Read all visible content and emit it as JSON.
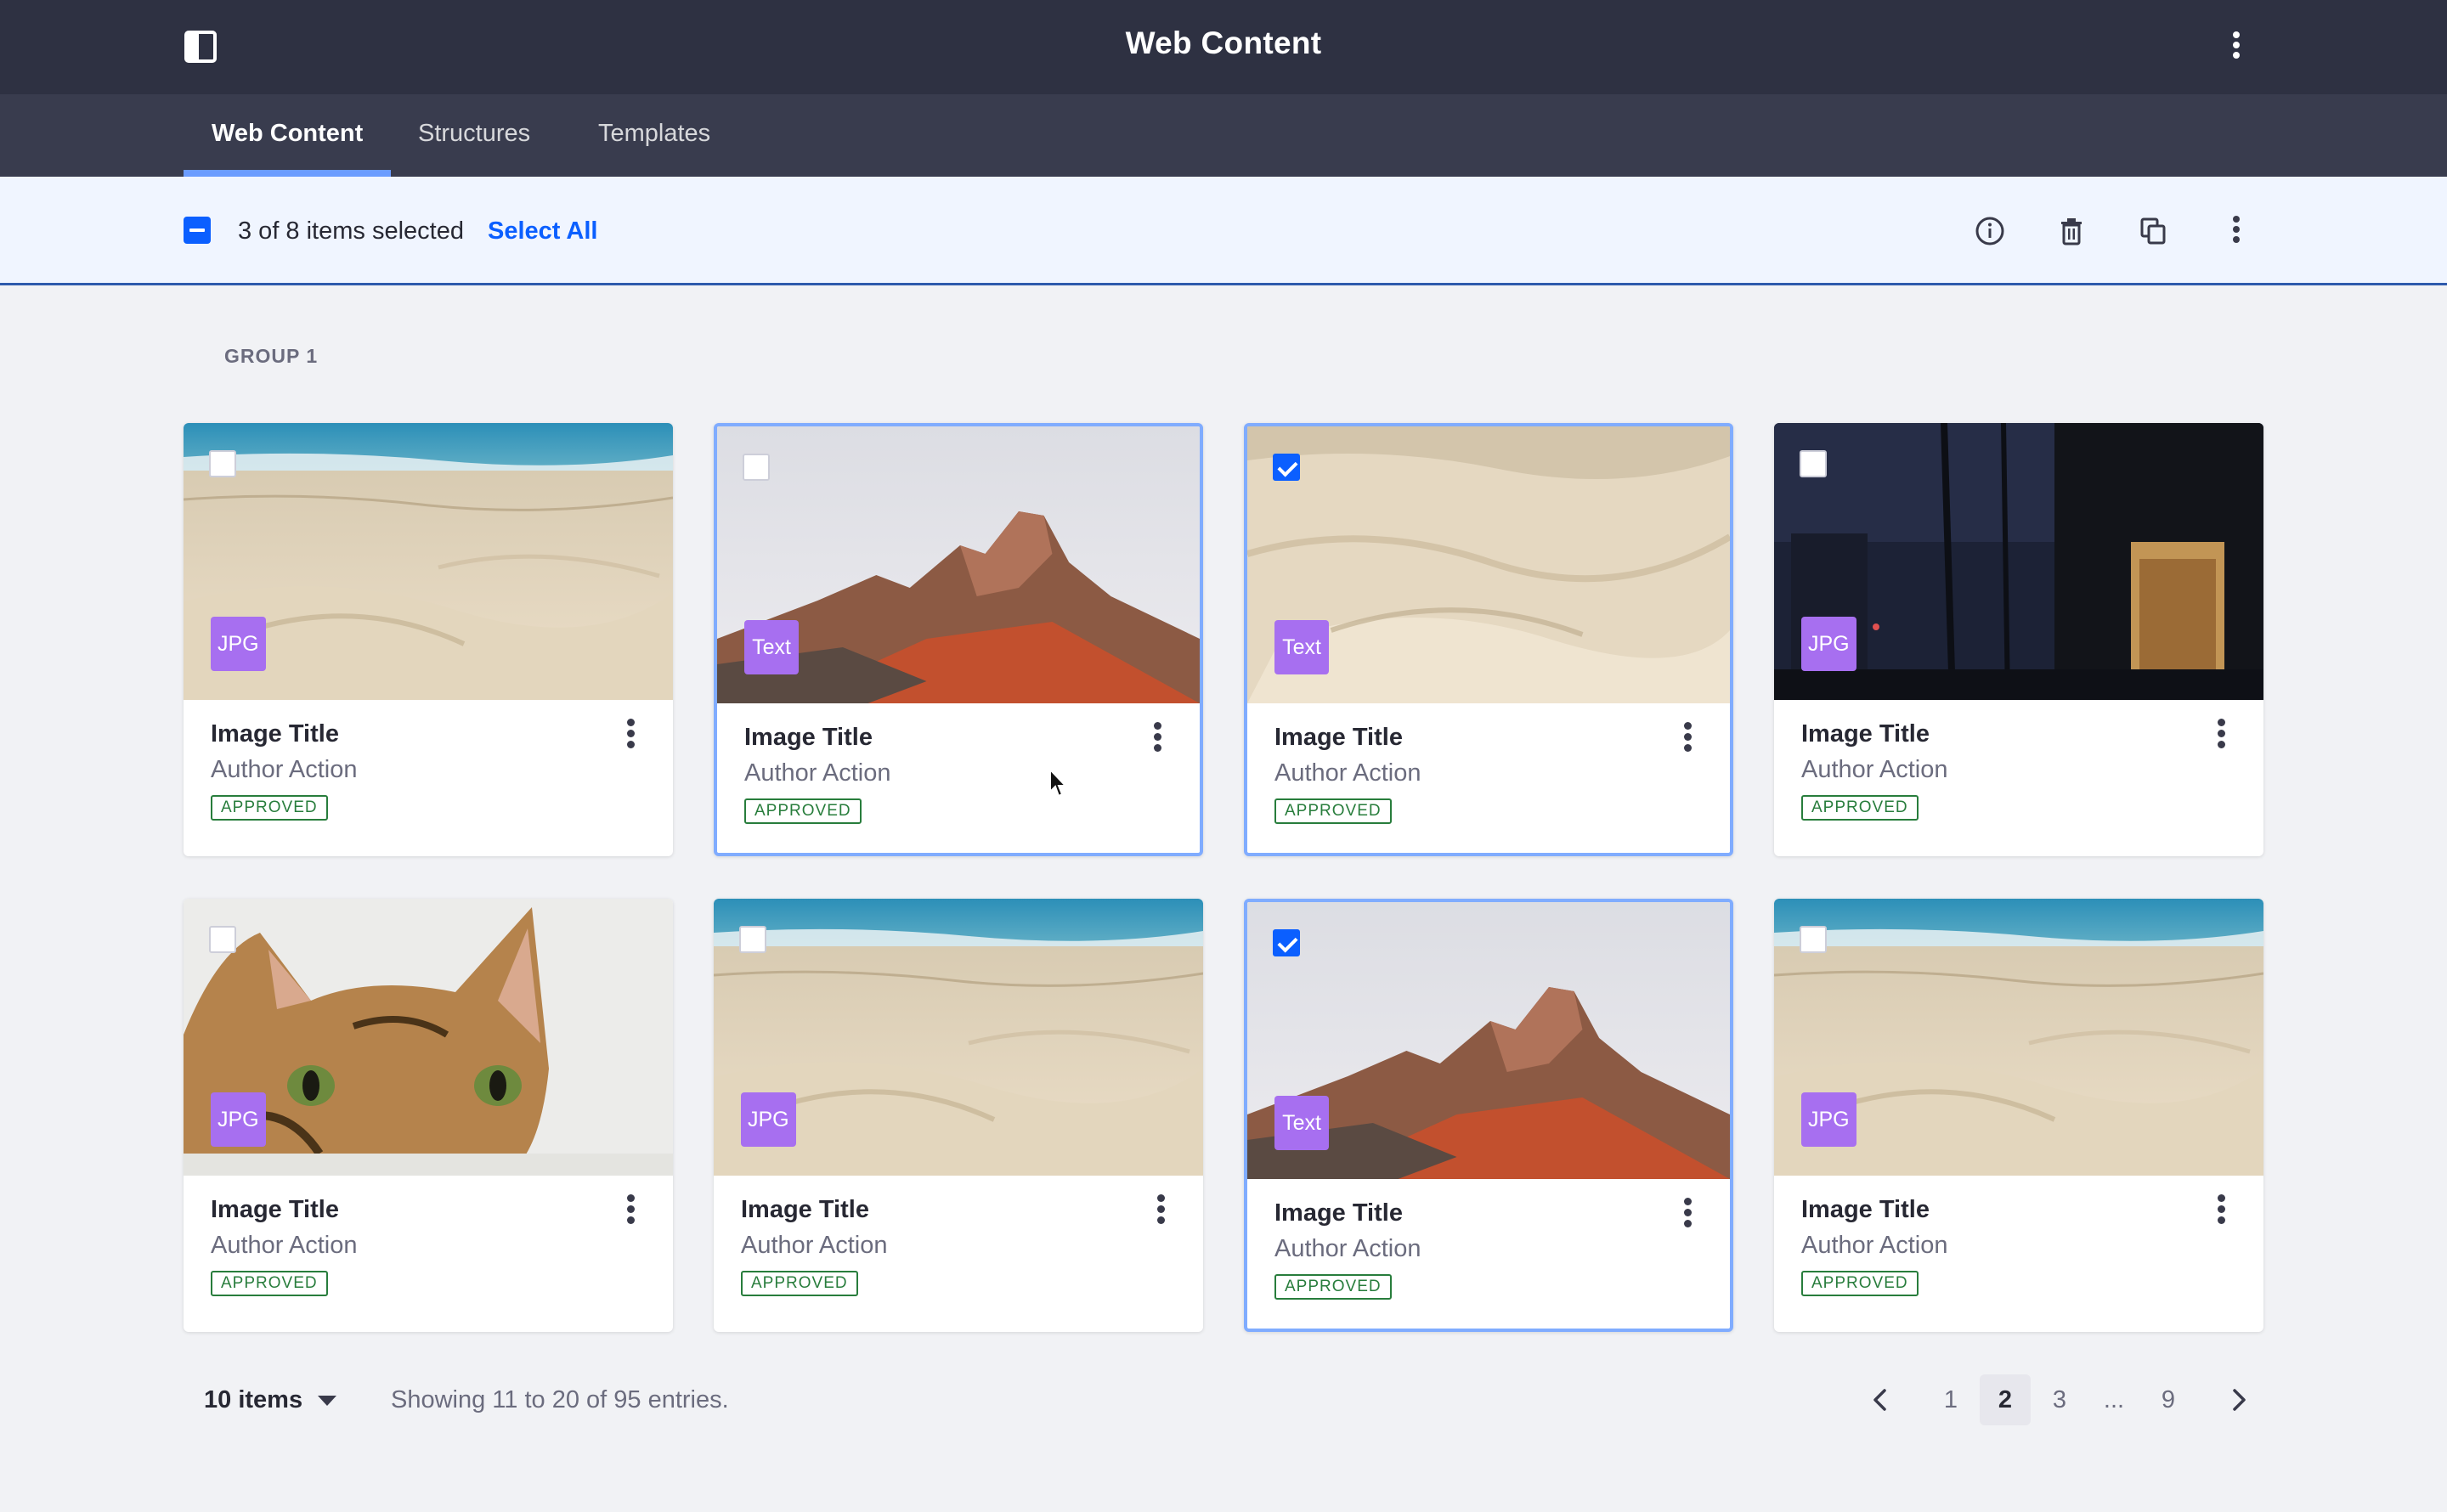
{
  "app": {
    "title": "Web Content"
  },
  "tabs": [
    {
      "label": "Web Content",
      "active": true
    },
    {
      "label": "Structures",
      "active": false
    },
    {
      "label": "Templates",
      "active": false
    }
  ],
  "management_bar": {
    "selection_text": "3 of 8 items selected",
    "select_all_label": "Select All",
    "actions": [
      "info-icon",
      "trash-icon",
      "copy-icon",
      "kebab-icon"
    ]
  },
  "group": {
    "label": "GROUP 1"
  },
  "cards": [
    {
      "title": "Image Title",
      "subtitle": "Author Action",
      "status": "APPROVED",
      "badge": "JPG",
      "image": "beach",
      "checked": false,
      "selected": false
    },
    {
      "title": "Image Title",
      "subtitle": "Author Action",
      "status": "APPROVED",
      "badge": "Text",
      "image": "mountain",
      "checked": false,
      "selected": true
    },
    {
      "title": "Image Title",
      "subtitle": "Author Action",
      "status": "APPROVED",
      "badge": "Text",
      "image": "sand",
      "checked": true,
      "selected": true
    },
    {
      "title": "Image Title",
      "subtitle": "Author Action",
      "status": "APPROVED",
      "badge": "JPG",
      "image": "city",
      "checked": false,
      "selected": false
    },
    {
      "title": "Image Title",
      "subtitle": "Author Action",
      "status": "APPROVED",
      "badge": "JPG",
      "image": "cat",
      "checked": false,
      "selected": false
    },
    {
      "title": "Image Title",
      "subtitle": "Author Action",
      "status": "APPROVED",
      "badge": "JPG",
      "image": "beach",
      "checked": false,
      "selected": false
    },
    {
      "title": "Image Title",
      "subtitle": "Author Action",
      "status": "APPROVED",
      "badge": "Text",
      "image": "mountain",
      "checked": true,
      "selected": true
    },
    {
      "title": "Image Title",
      "subtitle": "Author Action",
      "status": "APPROVED",
      "badge": "JPG",
      "image": "beach",
      "checked": false,
      "selected": false
    }
  ],
  "footer": {
    "per_page": "10 items",
    "showing": "Showing 11 to 20 of 95 entries.",
    "pages": [
      "1",
      "2",
      "3",
      "...",
      "9"
    ],
    "current_page": "2"
  },
  "colors": {
    "topbar": "#2e3142",
    "navbar": "#393c4e",
    "accent": "#0b5fff",
    "badge": "#a76ff0",
    "approved": "#287d3c"
  }
}
